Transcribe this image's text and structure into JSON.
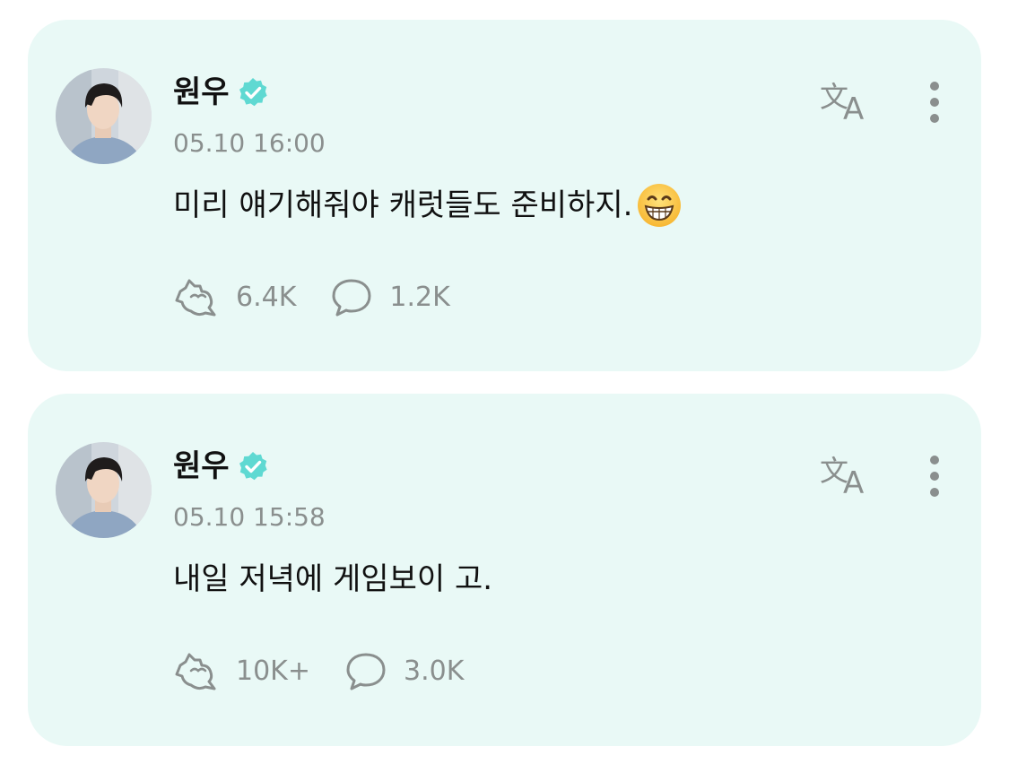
{
  "colors": {
    "card_bg": "#e9f9f6",
    "verified_badge": "#5fd9d2",
    "muted_text": "#8a8f8e",
    "main_text": "#111111"
  },
  "posts": [
    {
      "author": "원우",
      "verified_icon": "verified-badge-icon",
      "timestamp": "05.10 16:00",
      "text": "미리 얘기해줘야 캐럿들도 준비하지.",
      "emoji": "grinning-face-with-smiling-eyes",
      "likes": "6.4K",
      "comments": "1.2K",
      "like_icon": "heart-cheer-icon",
      "comment_icon": "speech-bubble-icon",
      "translate_icon": "translate-icon",
      "more_icon": "more-vertical-icon"
    },
    {
      "author": "원우",
      "verified_icon": "verified-badge-icon",
      "timestamp": "05.10 15:58",
      "text": "내일 저녁에 게임보이 고.",
      "likes": "10K+",
      "comments": "3.0K",
      "like_icon": "heart-cheer-icon",
      "comment_icon": "speech-bubble-icon",
      "translate_icon": "translate-icon",
      "more_icon": "more-vertical-icon"
    }
  ]
}
